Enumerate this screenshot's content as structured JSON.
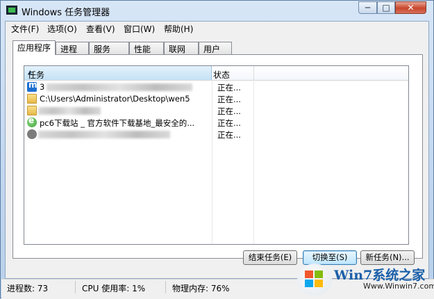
{
  "window": {
    "title": "Windows 任务管理器"
  },
  "title_buttons": {
    "minimize": "─",
    "maximize": "□",
    "close": "✕"
  },
  "menu": [
    "文件(F)",
    "选项(O)",
    "查看(V)",
    "窗口(W)",
    "帮助(H)"
  ],
  "tabs": [
    "应用程序",
    "进程",
    "服务",
    "性能",
    "联网",
    "用户"
  ],
  "active_tab": "应用程序",
  "list": {
    "columns": {
      "task": "任务",
      "status": "状态"
    },
    "rows": [
      {
        "icon": "maxthon-icon",
        "name": "3",
        "status": "正在..."
      },
      {
        "icon": "folder-icon",
        "name": "C:\\Users\\Administrator\\Desktop\\wen5",
        "status": "正在..."
      },
      {
        "icon": "folder-icon",
        "name": "",
        "status": "正在..."
      },
      {
        "icon": "ie-icon",
        "name": "pc6下载站 _ 官方软件下载基地_最安全的...",
        "status": "正在..."
      },
      {
        "icon": "gear-icon",
        "name": "",
        "status": "正在..."
      }
    ]
  },
  "buttons": {
    "end_task": "结束任务(E)",
    "switch_to": "切换至(S)",
    "new_task": "新任务(N)..."
  },
  "statusbar": {
    "processes": "进程数: 73",
    "cpu": "CPU 使用率: 1%",
    "memory": "物理内存: 76%"
  },
  "watermark": {
    "title": "Win7系统之家",
    "url": "Www.Winwin7.com"
  }
}
